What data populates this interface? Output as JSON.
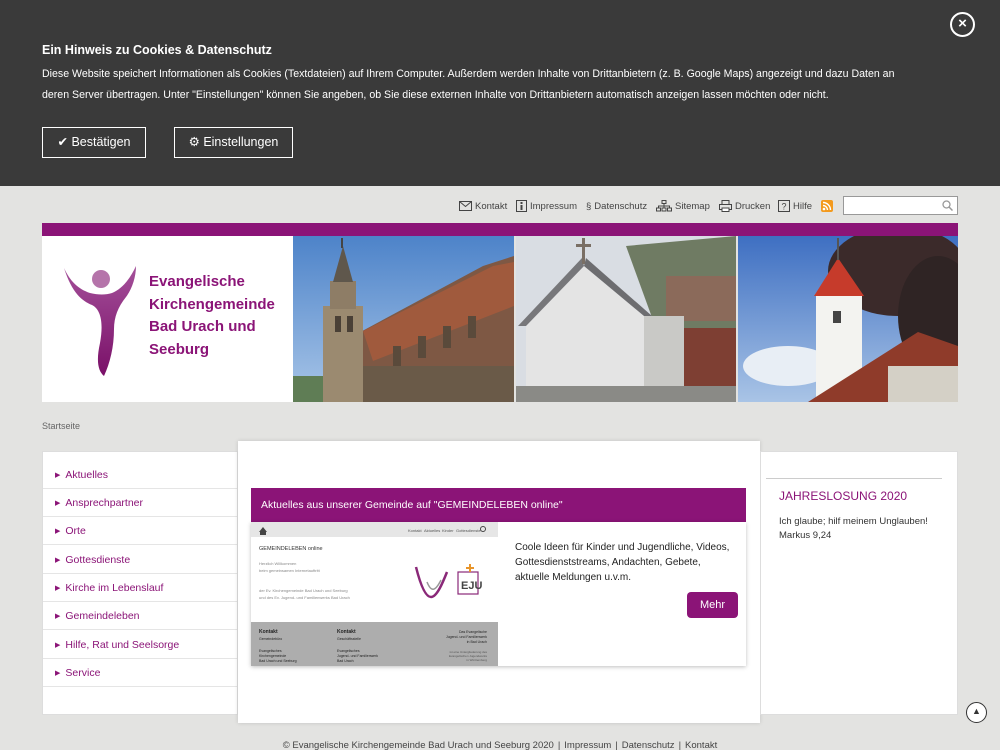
{
  "cookie": {
    "title": "Ein Hinweis zu Cookies & Datenschutz",
    "text": "Diese Website speichert Informationen als Cookies (Textdateien) auf Ihrem Computer. Außerdem werden Inhalte von Drittanbietern (z. B. Google Maps) angezeigt und dazu Daten an deren Server übertragen. Unter \"Einstellungen\" können Sie angeben, ob Sie diese externen Inhalte von Drittanbietern automatisch anzeigen lassen möchten oder nicht.",
    "confirm_label": "Bestätigen",
    "settings_label": "Einstellungen",
    "close_symbol": "×",
    "confirm_icon": "✔",
    "settings_icon": "⚙"
  },
  "toolbar": {
    "contact": "Kontakt",
    "imprint": "Impressum",
    "privacy": "Datenschutz",
    "sitemap": "Sitemap",
    "print": "Drucken",
    "help": "Hilfe",
    "search_value": ""
  },
  "header": {
    "site_title": "Evangelische Kirchengemeinde Bad Urach und Seeburg",
    "brand_color": "#8b1477"
  },
  "breadcrumb": "Startseite",
  "nav": [
    {
      "label": "Aktuelles"
    },
    {
      "label": "Ansprechpartner"
    },
    {
      "label": "Orte"
    },
    {
      "label": "Gottesdienste"
    },
    {
      "label": "Kirche im Lebenslauf"
    },
    {
      "label": "Gemeindeleben"
    },
    {
      "label": "Hilfe, Rat und Seelsorge"
    },
    {
      "label": "Service"
    }
  ],
  "news": {
    "heading": "Aktuelles aus unserer Gemeinde auf \"GEMEINDELEBEN online\"",
    "text": "Coole Ideen für Kinder und Jugendliche, Videos, Gottesdienststreams, Andachten, Gebete, aktuelle Meldungen u.v.m.",
    "more_label": "Mehr",
    "thumb": {
      "nav": [
        "Kontakt",
        "Aktuelles",
        "Kinder",
        "Gottesdienste"
      ],
      "title": "GEMEINDELEBEN online",
      "greeting": [
        "Herzlich Willkommen",
        "beim gemeinsamen Internetauftritt"
      ],
      "intro": [
        "der Ev. Kirchengemeinde Bad Urach und Seeburg",
        "und des Ev. Jugend- und Familienwerks Bad Urach"
      ],
      "col1_head": "Kontakt",
      "col1_sub": "Gemeindebüro",
      "col1_lines": [
        "Evangelisches",
        "Kirchengemeinde",
        "Bad Urach und Seeburg"
      ],
      "col2_head": "Kontakt",
      "col2_sub": "Geschäftsstelle",
      "col2_lines": [
        "Evangelisches",
        "Jugend- und Familienwerk",
        "Bad Urach"
      ],
      "col3_lines": [
        "Das Evangelische",
        "Jugend- und Familienwerk",
        "in Bad Urach"
      ],
      "col3_small": [
        "ist eine Untergliederung des",
        "Evangelischen Jugendwerks",
        "in Württemberg"
      ]
    }
  },
  "sidebar": {
    "title": "JAHRESLOSUNG 2020",
    "verse": "Ich glaube; hilf meinem Unglauben!",
    "reference": "Markus 9,24"
  },
  "footer": {
    "copyright": "© Evangelische Kirchengemeinde Bad Urach und Seeburg 2020",
    "imprint": "Impressum",
    "privacy": "Datenschutz",
    "contact": "Kontakt",
    "separator": "|"
  }
}
